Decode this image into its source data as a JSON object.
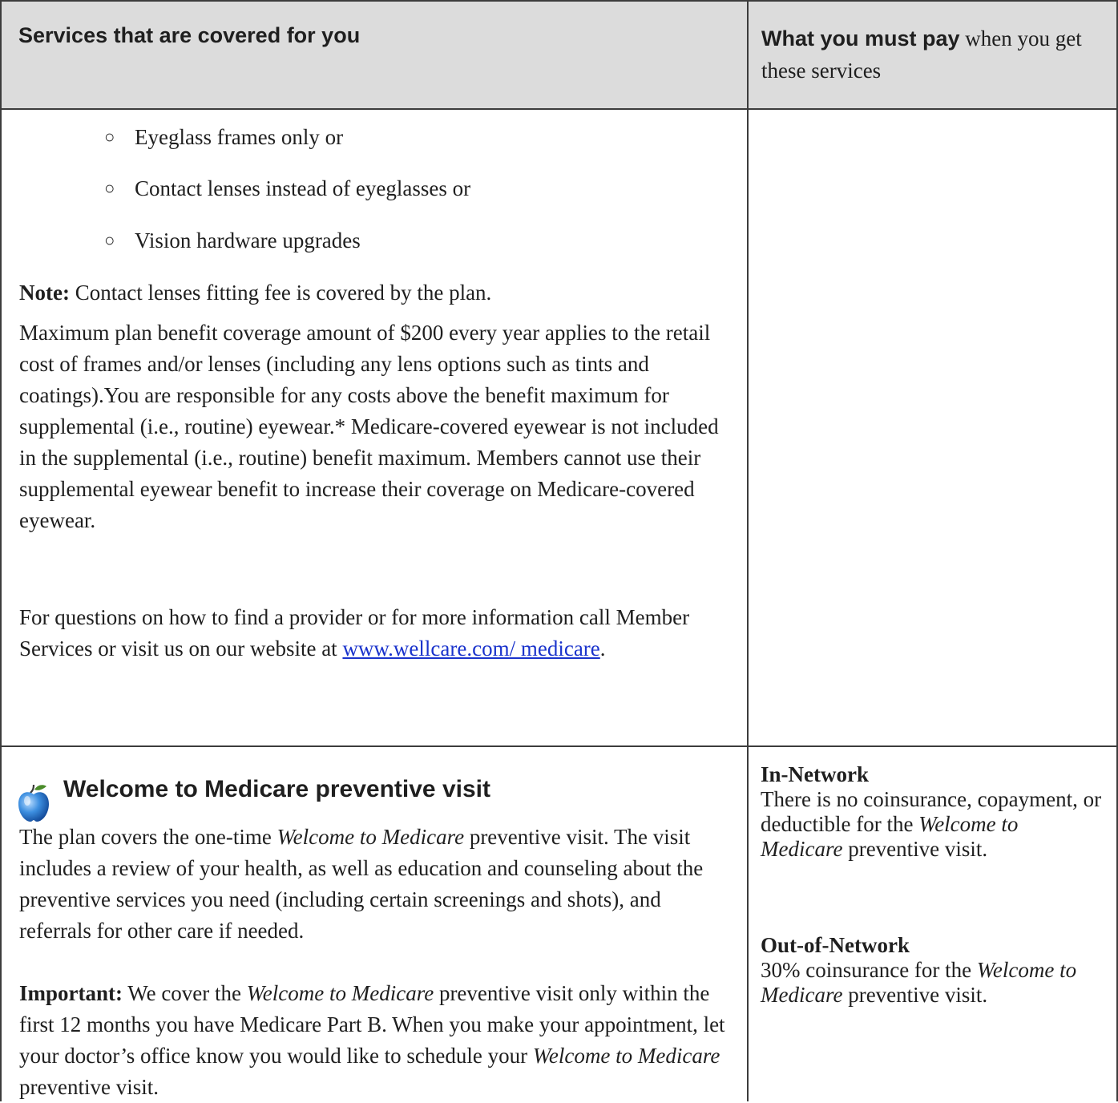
{
  "header": {
    "left_title": "Services that are covered for you",
    "right_bold": "What you must pay",
    "right_rest": " when you get these services"
  },
  "vision": {
    "bullets": [
      "Eyeglass frames only or",
      "Contact lenses instead of eyeglasses or",
      "Vision hardware upgrades"
    ],
    "bullet_mark": "○",
    "note_label": "Note:",
    "note_text": " Contact lenses fitting fee is covered by the plan.",
    "max_paragraph": "Maximum plan benefit coverage amount of $200 every year applies to the retail cost of frames and/or lenses (including any lens options such as tints and coatings).You are responsible for any costs above the benefit maximum for supplemental (i.e., routine) eyewear.* Medicare-covered eyewear is not included in the supplemental (i.e., routine) benefit maximum. Members cannot use their supplemental eyewear benefit to increase their coverage on Medicare-covered eyewear.",
    "questions_text": "For questions on how to find a provider or for more information call Member Services or visit us on our website at ",
    "link_text": "www.wellcare.com/ medicare",
    "questions_end": "."
  },
  "welcome": {
    "icon": "apple-icon",
    "title": "Welcome to Medicare preventive visit",
    "para1_a": "The plan covers the one-time ",
    "para1_italic": "Welcome to Medicare",
    "para1_b": " preventive visit. The visit includes a review of your health, as well as education and counseling about the preventive services you need (including certain screenings and shots), and referrals for other care if needed.",
    "important_label": "Important:",
    "para2_a": " We cover the ",
    "para2_italic": "Welcome to Medicare",
    "para2_b": " preventive visit only within the first 12 months you have Medicare Part B. When you make your appointment, let your doctor’s office know you would like to schedule your ",
    "para2_italic2": "Welcome to Medicare",
    "para2_c": " preventive visit."
  },
  "payment": {
    "in_network_label": "In-Network",
    "in_network_a": "There is no coinsurance, copayment, or deductible for the ",
    "in_network_italic": "Welcome to Medicare",
    "in_network_b": " preventive visit.",
    "out_network_label": "Out-of-Network",
    "out_network_a": "30% coinsurance for the ",
    "out_network_italic": "Welcome to Medicare",
    "out_network_b": " preventive visit."
  }
}
